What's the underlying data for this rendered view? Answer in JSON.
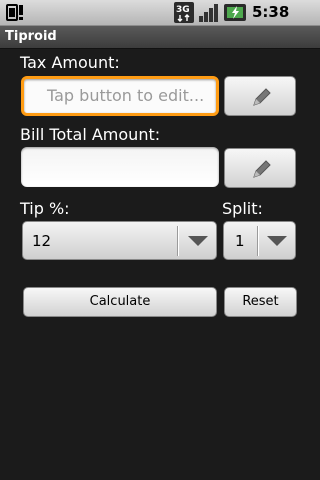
{
  "status_bar": {
    "network": "3G",
    "time": "5:38 AM",
    "icons": [
      "notification-icon",
      "3g-icon",
      "signal-icon",
      "battery-icon"
    ]
  },
  "app": {
    "title": "Tiproid"
  },
  "form": {
    "tax_label": "Tax Amount:",
    "tax_placeholder": "Tap button to edit...",
    "tax_value": "",
    "bill_label": "Bill Total Amount:",
    "bill_value": "",
    "tip_label": "Tip %:",
    "tip_value": "12",
    "split_label": "Split:",
    "split_value": "1"
  },
  "buttons": {
    "calculate": "Calculate",
    "reset": "Reset"
  },
  "colors": {
    "focus": "#ff9c14",
    "background": "#1b1b1b"
  }
}
